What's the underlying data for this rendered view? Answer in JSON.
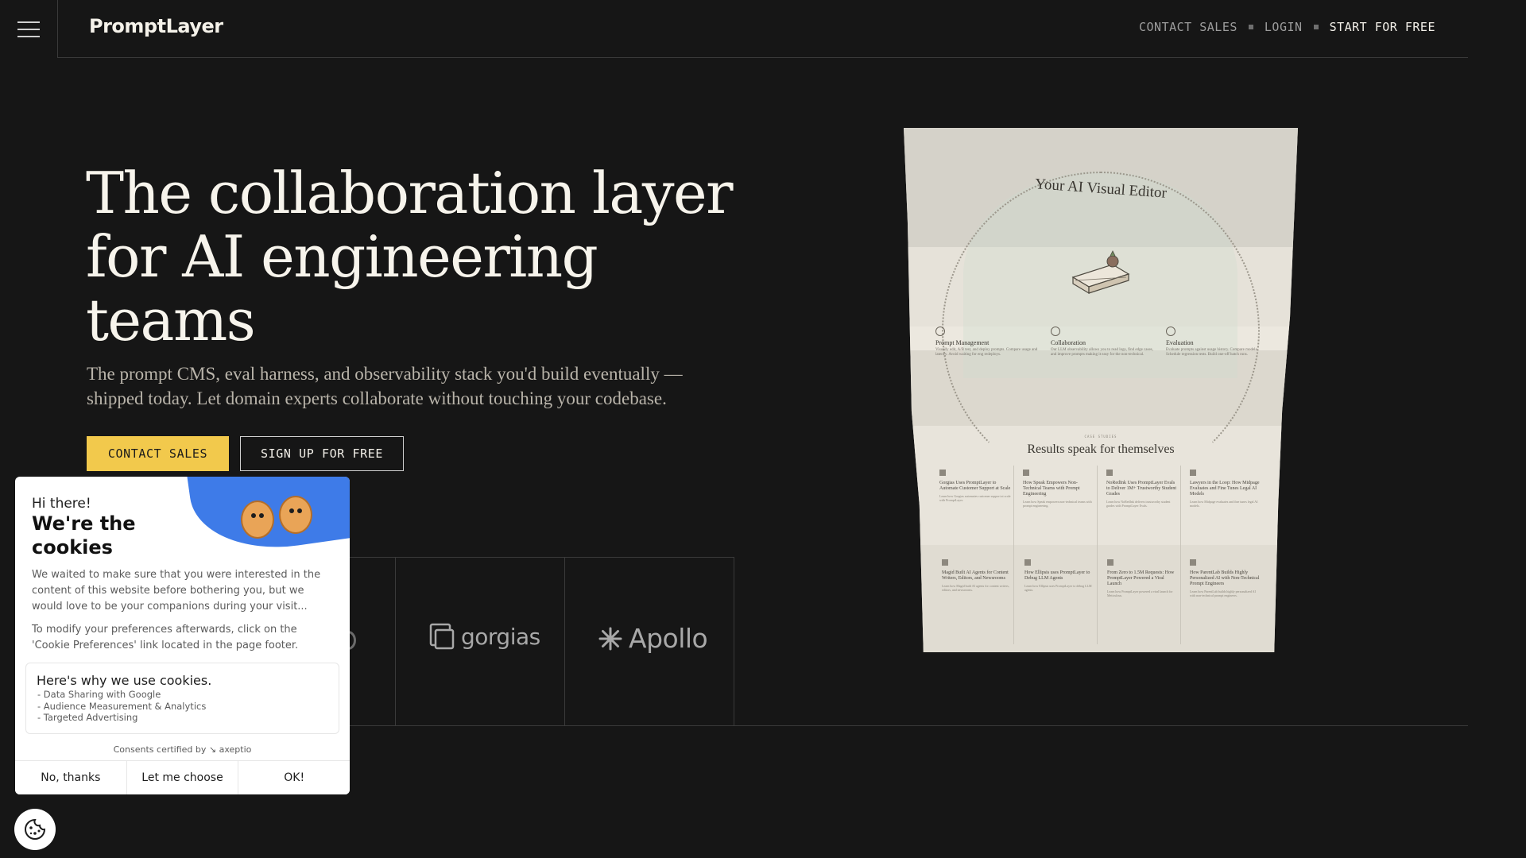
{
  "header": {
    "logo": "PromptLayer",
    "nav": {
      "contact_sales": "CONTACT SALES",
      "login": "LOGIN",
      "start_free": "START FOR FREE"
    }
  },
  "hero": {
    "title": "The collaboration layer for AI engineering teams",
    "subtitle": "The prompt CMS, eval harness, and observability stack you'd build eventually — shipped today. Let domain experts collaborate without touching your codebase.",
    "cta_primary": "CONTACT SALES",
    "cta_secondary": "SIGN UP FOR FREE"
  },
  "partners": {
    "items": [
      "gorgias",
      "Apollo"
    ]
  },
  "poster": {
    "title": "Your AI Visual Editor",
    "features": [
      {
        "name": "Prompt Management",
        "desc": "Visually edit, A/B test, and deploy prompts. Compare usage and latency. Avoid waiting for eng redeploys."
      },
      {
        "name": "Collaboration",
        "desc": "Our LLM observability allows you to read logs, find edge cases, and improve prompts making it easy for the non-technical."
      },
      {
        "name": "Evaluation",
        "desc": "Evaluate prompts against usage history. Compare models. Schedule regression tests. Build one-off batch runs."
      }
    ],
    "kicker": "CASE STUDIES",
    "results_title": "Results speak for themselves",
    "cases": [
      {
        "title": "Gorgias Uses PromptLayer to Automate Customer Support at Scale",
        "desc": "Learn how Gorgias automates customer support at scale with PromptLayer."
      },
      {
        "title": "How Speak Empowers Non-Technical Teams with Prompt Engineering",
        "desc": "Learn how Speak empowers non-technical teams with prompt engineering."
      },
      {
        "title": "NoRedInk Uses PromptLayer Evals to Deliver 1M+ Trustworthy Student Grades",
        "desc": "Learn how NoRedInk delivers trustworthy student grades with PromptLayer Evals."
      },
      {
        "title": "Lawyers in the Loop: How Midpage Evaluates and Fine Tunes Legal AI Models",
        "desc": "Learn how Midpage evaluates and fine tunes legal AI models."
      },
      {
        "title": "Magid Built AI Agents for Content Writers, Editors, and Newsrooms",
        "desc": "Learn how Magid built AI agents for content writers, editors, and newsrooms."
      },
      {
        "title": "How Ellipsis uses PromptLayer to Debug LLM Agents",
        "desc": "Learn how Ellipsis uses PromptLayer to debug LLM agents."
      },
      {
        "title": "From Zero to 1.5M Requests: How PromptLayer Powered a Viral Launch",
        "desc": "Learn how PromptLayer powered a viral launch for Meticulous."
      },
      {
        "title": "How ParentLab Builds Highly Personalized AI with Non-Technical Prompt Engineers",
        "desc": "Learn how ParentLab builds highly personalized AI with non-technical prompt engineers."
      }
    ]
  },
  "cookie_banner": {
    "greeting": "Hi there!",
    "title": "We're the cookies",
    "message": "We waited to make sure that you were interested in the content of this website before bothering you, but we would love to be your companions during your visit...",
    "preferences_note": "To modify your preferences afterwards, click on the 'Cookie Preferences' link located in the page footer.",
    "why_title": "Here's why we use cookies.",
    "reasons": [
      "- Data Sharing with Google",
      "- Audience Measurement & Analytics",
      "- Targeted Advertising"
    ],
    "certified": "Consents certified by ↘ axeptio",
    "buttons": {
      "decline": "No, thanks",
      "choose": "Let me choose",
      "accept": "OK!"
    }
  },
  "colors": {
    "background": "#161616",
    "accent": "#f2c94c",
    "cookie_blue": "#3e7be8"
  },
  "icons": {
    "menu": "hamburger-menu-icon",
    "cookie_fab": "cookie-icon",
    "gorgias": "gorgias-logo-icon",
    "apollo": "apollo-asterisk-icon"
  }
}
